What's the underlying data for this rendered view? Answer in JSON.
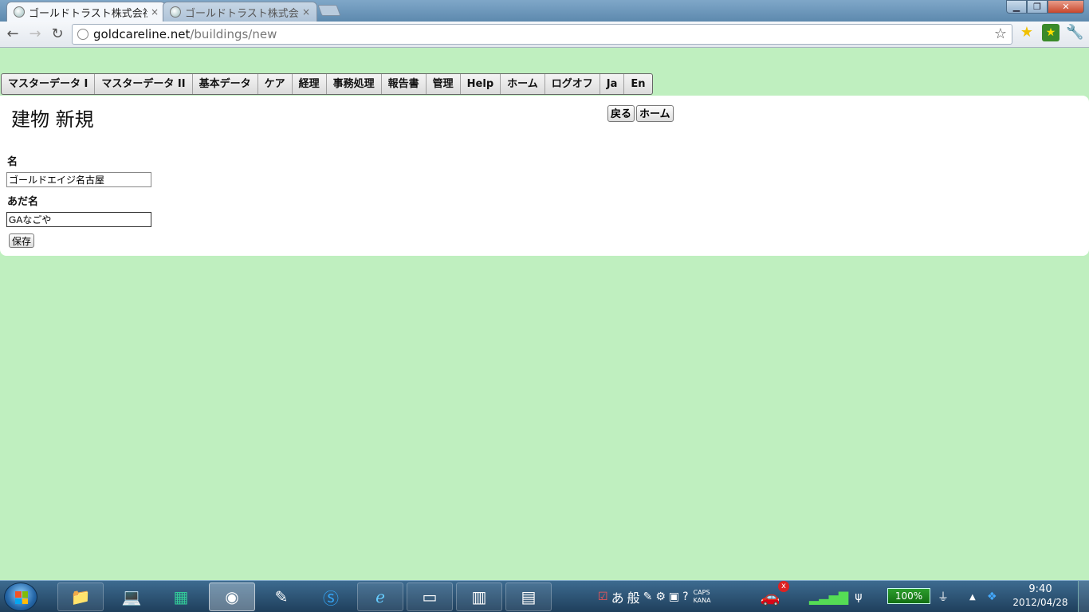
{
  "browser": {
    "tabs": [
      {
        "label": "ゴールドトラスト株式会社",
        "close": "×"
      },
      {
        "label": "ゴールドトラスト株式会社",
        "close": "×"
      }
    ],
    "url_host": "goldcareline.net",
    "url_path": "/buildings/new",
    "window_buttons": {
      "minimize": "▁",
      "maximize": "❐",
      "close": "✕"
    }
  },
  "menu": {
    "items": [
      "マスターデータ I",
      "マスターデータ II",
      "基本データ",
      "ケア",
      "経理",
      "事務処理",
      "報告書",
      "管理",
      "Help",
      "ホーム",
      "ログオフ",
      "Ja",
      "En"
    ]
  },
  "page": {
    "title": "建物 新規",
    "back_button": "戻る",
    "home_button": "ホーム",
    "fields": {
      "name_label": "名",
      "name_value": "ゴールドエイジ名古屋",
      "nickname_label": "あだ名",
      "nickname_value": "GAなごや"
    },
    "save_button": "保存"
  },
  "taskbar": {
    "ime_mode": "あ",
    "ime_kanji": "般",
    "caps": "CAPS",
    "kana": "KANA",
    "notification_badge": "x",
    "battery": "100%",
    "time": "9:40",
    "date": "2012/04/28"
  }
}
